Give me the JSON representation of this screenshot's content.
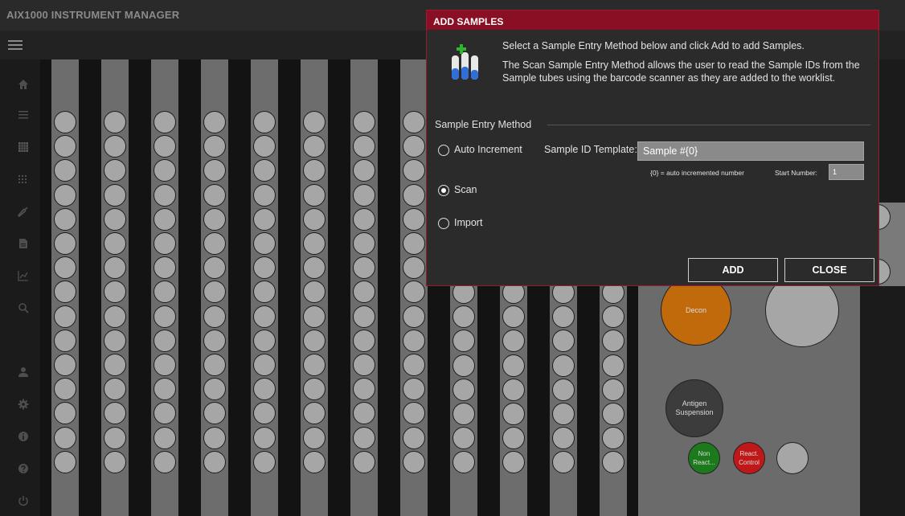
{
  "app": {
    "title": "AIX1000 INSTRUMENT MANAGER"
  },
  "nav": {
    "icons": [
      "menu-icon",
      "home-icon",
      "list-icon",
      "plate-grid-icon",
      "grid-dots-icon",
      "wrench-icon",
      "document-icon",
      "chart-icon",
      "search-icon",
      "user-icon",
      "gear-icon",
      "info-icon",
      "help-icon",
      "power-icon"
    ]
  },
  "reagents": {
    "decon": "Decon",
    "antigen": "Antigen Suspension",
    "non_reactive": "Non React...",
    "reactive_control": "React. Control"
  },
  "colors": {
    "dialog_header": "#8b0f24",
    "decon": "#c06a0c",
    "antigen": "#3c3c3c",
    "non_reactive": "#1c7a1c",
    "reactive_control": "#c01818"
  },
  "dialog": {
    "title": "ADD SAMPLES",
    "intro_1": "Select a Sample Entry Method below and click Add to add Samples.",
    "intro_2": "The Scan Sample Entry Method allows the user to read the Sample IDs from the Sample tubes using the barcode scanner as they are added to the worklist.",
    "section_label": "Sample Entry Method",
    "options": [
      {
        "label": "Auto Increment",
        "checked": false
      },
      {
        "label": "Scan",
        "checked": true
      },
      {
        "label": "Import",
        "checked": false
      }
    ],
    "template_label": "Sample ID Template:",
    "template_value": "Sample #{0}",
    "template_hint": "{0} = auto incremented number",
    "start_label": "Start Number:",
    "start_value": "1",
    "add_label": "ADD",
    "close_label": "CLOSE"
  }
}
